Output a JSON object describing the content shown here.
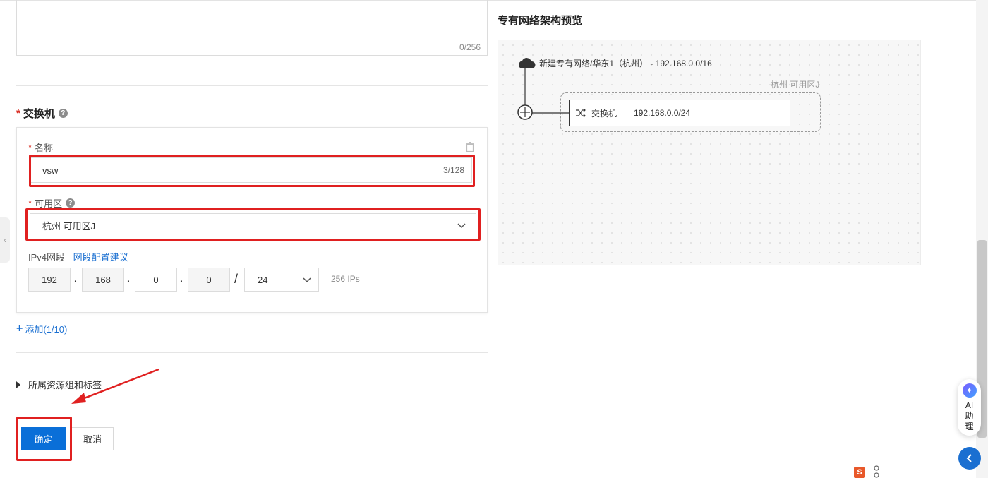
{
  "description": {
    "count": "0/256"
  },
  "vswitch": {
    "title": "交换机",
    "name_label": "名称",
    "name_value": "vsw",
    "name_count": "3/128",
    "zone_label": "可用区",
    "zone_value": "杭州 可用区J",
    "ipv4_label": "IPv4网段",
    "ipv4_link": "网段配置建议",
    "octets": [
      "192",
      "168",
      "0",
      "0"
    ],
    "mask": "24",
    "ip_count": "256 IPs",
    "add_label": "添加(1/10)"
  },
  "resource_group_label": "所属资源组和标签",
  "footer": {
    "confirm_label": "确定",
    "cancel_label": "取消"
  },
  "preview": {
    "title": "专有网络架构预览",
    "vpc_label": "新建专有网络/华东1（杭州） - 192.168.0.0/16",
    "zone_label": "杭州 可用区J",
    "switch_name": "交换机",
    "switch_cidr": "192.168.0.0/24"
  },
  "assistant": {
    "label_line1": "AI",
    "label_line2": "助",
    "label_line3": "理"
  },
  "colors": {
    "primary": "#0a6fd8",
    "highlight": "#e02020",
    "link": "#1a6fd1"
  }
}
